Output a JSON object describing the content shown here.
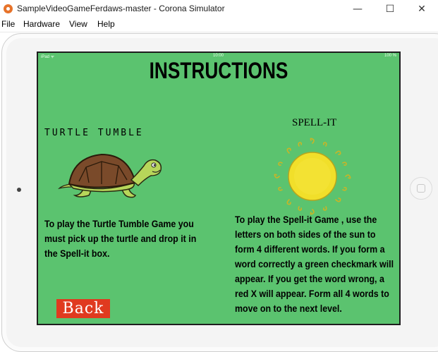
{
  "window": {
    "title": "SampleVideoGameFerdaws-master - Corona Simulator",
    "minimize": "—",
    "maximize": "☐",
    "close": "✕"
  },
  "menu": [
    "File",
    "Hardware",
    "View",
    "Help"
  ],
  "status_bar": {
    "carrier": "iPad ᯤ",
    "time": "10:00",
    "battery": "100 %"
  },
  "screen": {
    "heading": "INSTRUCTIONS",
    "turtle_title": "TURTLE TUMBLE",
    "spell_title": "SPELL-IT",
    "turtle_text": "To play the Turtle Tumble Game you must pick up the turtle and drop it in the Spell-it box.",
    "spell_text": "To play the Spell-it Game , use the letters on both sides of the sun to form 4 different words. If you form a word correctly a green checkmark will appear. If you get the word wrong, a red X will appear. Form all 4 words to move on to the next level.",
    "back_label": "Back"
  },
  "colors": {
    "screen_bg": "#5bc36f",
    "back_button": "#e03a1f",
    "sun": "#f1df2a",
    "turtle_shell": "#7a4a2a",
    "turtle_skin": "#b7d65a"
  }
}
